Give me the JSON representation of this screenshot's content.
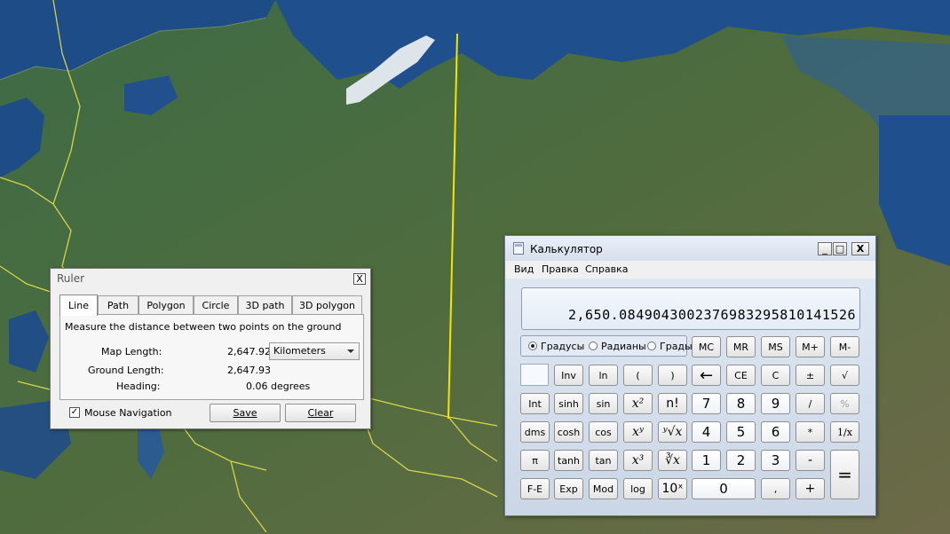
{
  "ruler": {
    "title": "Ruler",
    "close_label": "X",
    "tabs": [
      "Line",
      "Path",
      "Polygon",
      "Circle",
      "3D path",
      "3D polygon"
    ],
    "active_tab": "Line",
    "description": "Measure the distance between two points on the ground",
    "map_length_label": "Map Length:",
    "map_length_value": "2,647.92",
    "unit": "Kilometers",
    "ground_length_label": "Ground Length:",
    "ground_length_value": "2,647.93",
    "heading_label": "Heading:",
    "heading_value": "0.06 degrees",
    "mouse_nav_checked": true,
    "mouse_nav_label": "Mouse Navigation",
    "save_label": "Save",
    "clear_label": "Clear"
  },
  "calculator": {
    "title": "Калькулятор",
    "window_buttons": [
      "_",
      "□",
      "X"
    ],
    "menu": [
      "Вид",
      "Правка",
      "Справка"
    ],
    "display_value": "2,650.0849043002376983295810141526",
    "angle_modes": [
      "Градусы",
      "Радианы",
      "Грады"
    ],
    "selected_angle_mode": "Градусы",
    "memory": [
      "MC",
      "MR",
      "MS",
      "M+",
      "M-"
    ],
    "row1": [
      "Inv",
      "ln",
      "(",
      ")",
      "←",
      "CE",
      "C",
      "±",
      "√"
    ],
    "row2": [
      "Int",
      "sinh",
      "sin",
      "x²",
      "n!",
      "7",
      "8",
      "9",
      "/",
      "%"
    ],
    "row3": [
      "dms",
      "cosh",
      "cos",
      "xʸ",
      "ʸ√x",
      "4",
      "5",
      "6",
      "*",
      "1/x"
    ],
    "row4": [
      "π",
      "tanh",
      "tan",
      "x³",
      "∛x",
      "1",
      "2",
      "3",
      "-",
      "="
    ],
    "row5": [
      "F-E",
      "Exp",
      "Mod",
      "log",
      "10ˣ",
      "0",
      ",",
      "+"
    ]
  },
  "colors": {
    "map_line": "#f2e600",
    "border_yellow": "#e6e04a"
  }
}
